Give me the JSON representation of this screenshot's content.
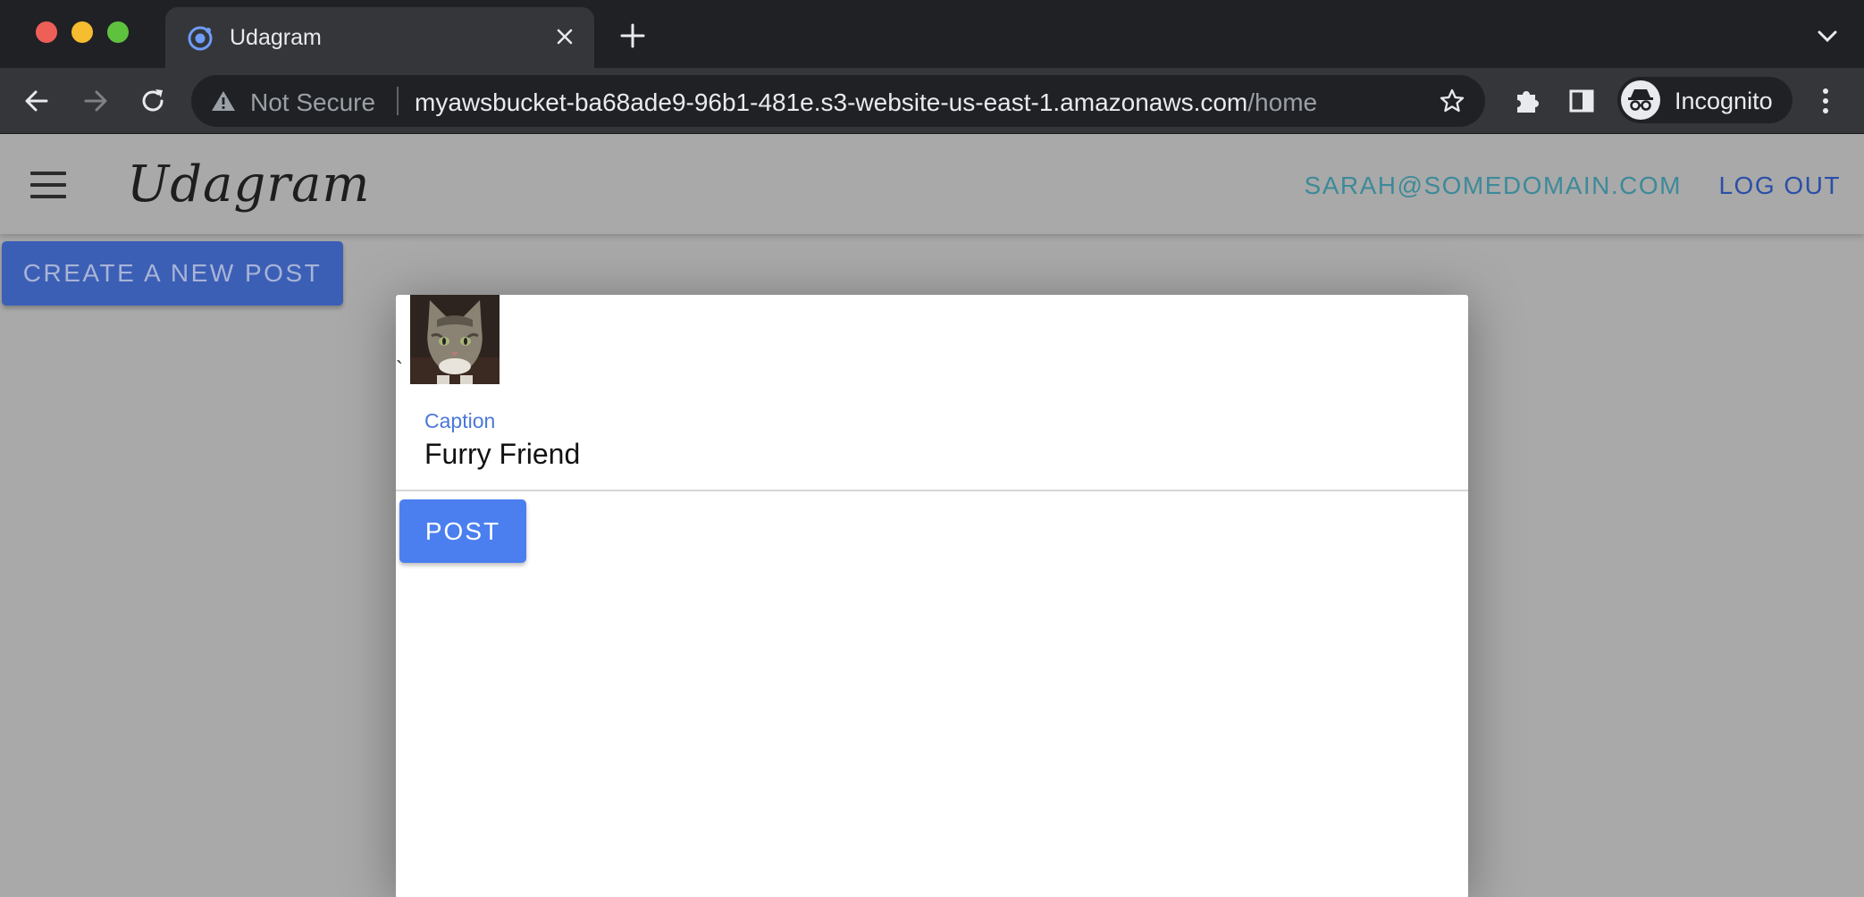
{
  "browser": {
    "tab_title": "Udagram",
    "security_label": "Not Secure",
    "url_host": "myawsbucket-ba68ade9-96b1-481e.s3-website-us-east-1.amazonaws.com",
    "url_path": "/home",
    "profile_label": "Incognito"
  },
  "header": {
    "brand": "Udagram",
    "user_email": "SARAH@SOMEDOMAIN.COM",
    "logout_label": "LOG OUT"
  },
  "main": {
    "create_button_label": "CREATE A NEW POST"
  },
  "modal": {
    "stray_char": "`",
    "caption_label": "Caption",
    "caption_value": "Furry Friend",
    "post_button_label": "POST"
  },
  "colors": {
    "brand_blue": "#4b7ff0",
    "accent_teal": "#3d8a99",
    "browser_dark": "#202124"
  }
}
